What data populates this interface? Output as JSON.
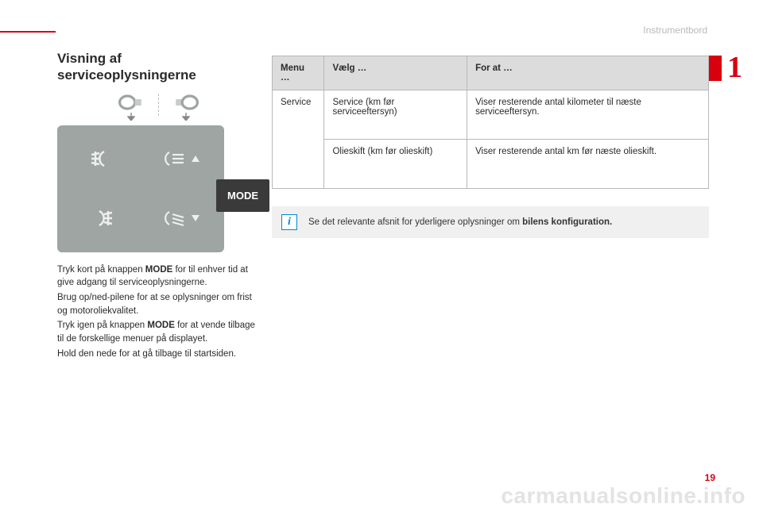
{
  "header": {
    "section": "Instrumentbord"
  },
  "chapter": {
    "number": "1",
    "page": "19"
  },
  "watermark": "carmanualsonline.info",
  "title": "Visning af serviceoplysningerne",
  "mode_label": "MODE",
  "body": {
    "p1a": "Tryk kort på knappen ",
    "p1b": "MODE",
    "p1c": " for til enhver tid at give adgang til serviceoplysningerne.",
    "p2": "Brug op/ned-pilene for at se oplysninger om frist og motoroliekvalitet.",
    "p3a": "Tryk igen på knappen ",
    "p3b": "MODE",
    "p3c": " for at vende tilbage til de forskellige menuer på displayet.",
    "p4": "Hold den nede for at gå tilbage til startsiden."
  },
  "table": {
    "headers": {
      "menu": "Menu …",
      "select": "Vælg …",
      "purpose": "For at …"
    },
    "rows": [
      {
        "menu": "Service",
        "select": "Service (km før serviceeftersyn)",
        "purpose": "Viser resterende antal kilometer til næste serviceeftersyn."
      },
      {
        "menu": "",
        "select": "Olieskift (km før olieskift)",
        "purpose": "Viser resterende antal km før næste olieskift."
      }
    ]
  },
  "info": {
    "text": "Se det relevante afsnit for yderligere oplysninger om ",
    "bold": "bilens konfiguration."
  }
}
